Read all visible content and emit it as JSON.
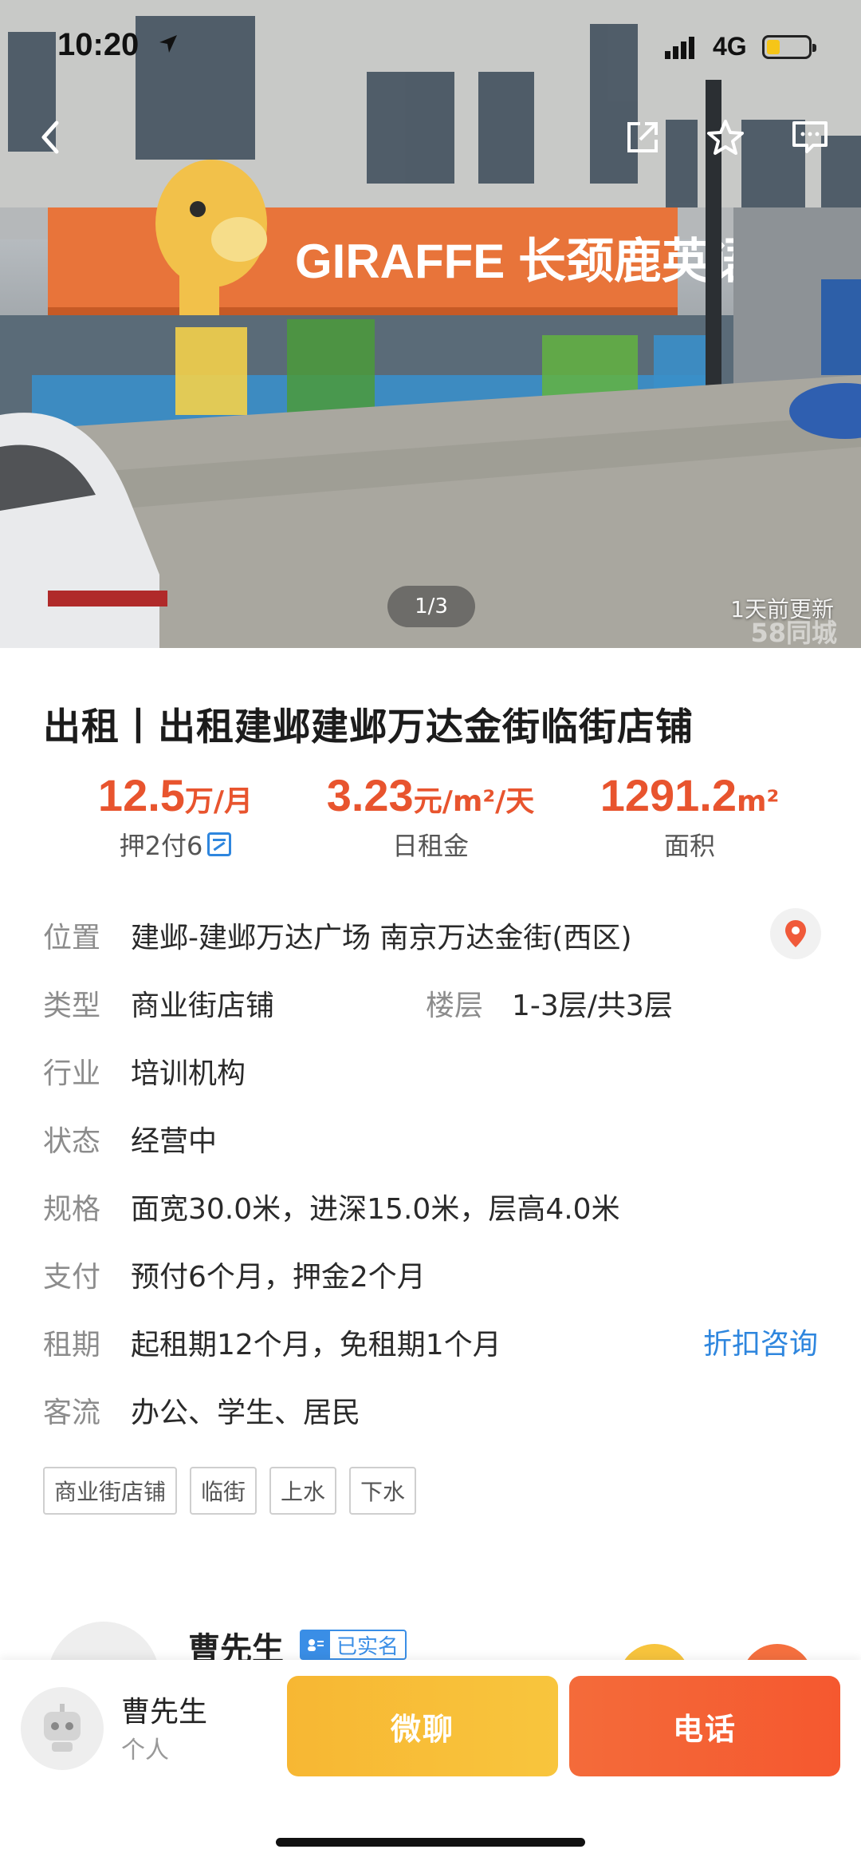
{
  "status_bar": {
    "time": "10:20",
    "network": "4G"
  },
  "gallery": {
    "page_indicator": "1/3",
    "updated": "1天前更新",
    "watermark": "58同城"
  },
  "listing": {
    "title": "出租丨出租建邺建邺万达金街临街店铺",
    "stats": [
      {
        "num": "12.5",
        "unit": "万/月",
        "label": "押2付6"
      },
      {
        "num": "3.23",
        "unit": "元/m²/天",
        "label": "日租金"
      },
      {
        "num": "1291.2",
        "unit": "m²",
        "label": "面积"
      }
    ],
    "details": {
      "location_key": "位置",
      "location_val": "建邺-建邺万达广场 南京万达金街(西区)",
      "type_key": "类型",
      "type_val": "商业街店铺",
      "floor_key": "楼层",
      "floor_val": "1-3层/共3层",
      "industry_key": "行业",
      "industry_val": "培训机构",
      "status_key": "状态",
      "status_val": "经营中",
      "spec_key": "规格",
      "spec_val": "面宽30.0米，进深15.0米，层高4.0米",
      "payment_key": "支付",
      "payment_val": "预付6个月，押金2个月",
      "lease_key": "租期",
      "lease_val": "起租期12个月，免租期1个月",
      "traffic_key": "客流",
      "traffic_val": "办公、学生、居民"
    },
    "discount_link": "折扣咨询",
    "tags": [
      "商业街店铺",
      "临街",
      "上水",
      "下水"
    ]
  },
  "agent_card": {
    "name": "曹先生",
    "verified": "已实名"
  },
  "bottom_bar": {
    "name": "曹先生",
    "role": "个人",
    "chat_label": "微聊",
    "call_label": "电话"
  },
  "colors": {
    "accent": "#e8542e",
    "link": "#2e86de",
    "chat": "#f7b733",
    "call": "#f5582f"
  }
}
